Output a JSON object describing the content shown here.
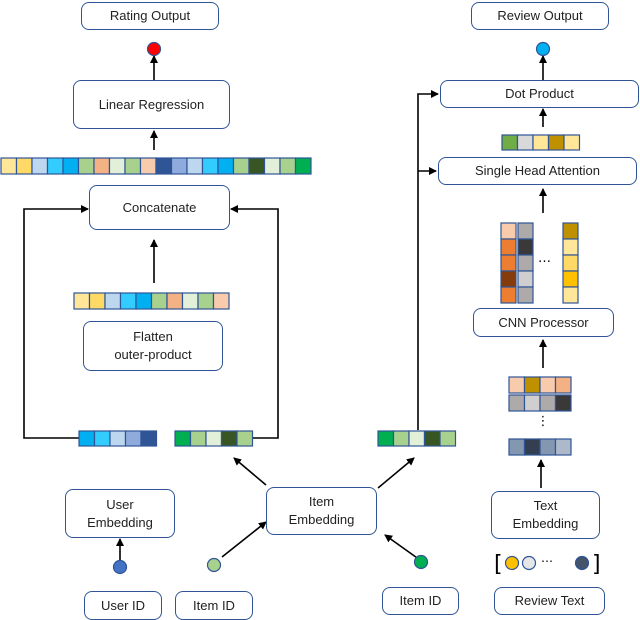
{
  "boxes": {
    "rating_output": "Rating Output",
    "linear_regression": "Linear Regression",
    "concatenate": "Concatenate",
    "flatten": "Flatten\nouter-product",
    "user_embedding": "User\nEmbedding",
    "user_id": "User ID",
    "item_id_left": "Item ID",
    "item_embedding": "Item\nEmbedding",
    "item_id_right": "Item ID",
    "review_output": "Review Output",
    "dot_product": "Dot Product",
    "single_head_attention": "Single Head Attention",
    "cnn_processor": "CNN Processor",
    "text_embedding": "Text\nEmbedding",
    "review_text": "Review Text"
  },
  "ellipsis": "…",
  "nodes": {
    "rating_output_color": "#ff0000",
    "review_output_color": "#00b0f0",
    "user_id_color": "#4472c4",
    "item_id_left_color": "#a9d18e",
    "item_id_right_color": "#00b050",
    "review_tokens": [
      "#ffc000",
      "#e7e6e6",
      "#44546a"
    ]
  },
  "vectors": {
    "concat": [
      "#ffe699",
      "#ffd966",
      "#bdd7ee",
      "#33ccff",
      "#00b0f0",
      "#a9d18e",
      "#f4b183",
      "#e2f0d9",
      "#a9d18e",
      "#f8cbad",
      "#2f5597",
      "#8faadc",
      "#bdd7ee",
      "#33ccff",
      "#00b0f0",
      "#a9d18e",
      "#375623",
      "#e2f0d9",
      "#a9d18e",
      "#00b050"
    ],
    "flatten": [
      "#ffe699",
      "#ffd966",
      "#bdd7ee",
      "#33ccff",
      "#00b0f0",
      "#a9d18e",
      "#f4b183",
      "#e2f0d9",
      "#a9d18e",
      "#f8cbad"
    ],
    "user": [
      "#00b0f0",
      "#33ccff",
      "#bdd7ee",
      "#8faadc",
      "#2f5597"
    ],
    "item_left": [
      "#00b050",
      "#a9d18e",
      "#e2f0d9",
      "#375623",
      "#a9d18e"
    ],
    "item_right": [
      "#00b050",
      "#a9d18e",
      "#e2f0d9",
      "#375623",
      "#a9d18e"
    ],
    "attention": [
      "#70ad47",
      "#d9d9d9",
      "#ffe699",
      "#bf9000",
      "#ffe699"
    ],
    "cnn_col1": [
      "#f8cbad",
      "#ed7d31",
      "#ed7d31",
      "#843c0c",
      "#ed7d31"
    ],
    "cnn_col2": [
      "#aeaaaa",
      "#3a3838",
      "#aeaaaa",
      "#d0cece",
      "#aeaaaa"
    ],
    "cnn_col3": [
      "#bf9000",
      "#ffe699",
      "#ffd966",
      "#ffc000",
      "#ffe699"
    ],
    "text_row1": [
      "#f8cbad",
      "#bf9000",
      "#f8cbad",
      "#f4b183"
    ],
    "text_row2": [
      "#aeaaaa",
      "#d0cece",
      "#aeaaaa",
      "#3a3838"
    ],
    "text_row3": [
      "#8497b0",
      "#333f50",
      "#8497b0",
      "#adb9ca"
    ]
  }
}
